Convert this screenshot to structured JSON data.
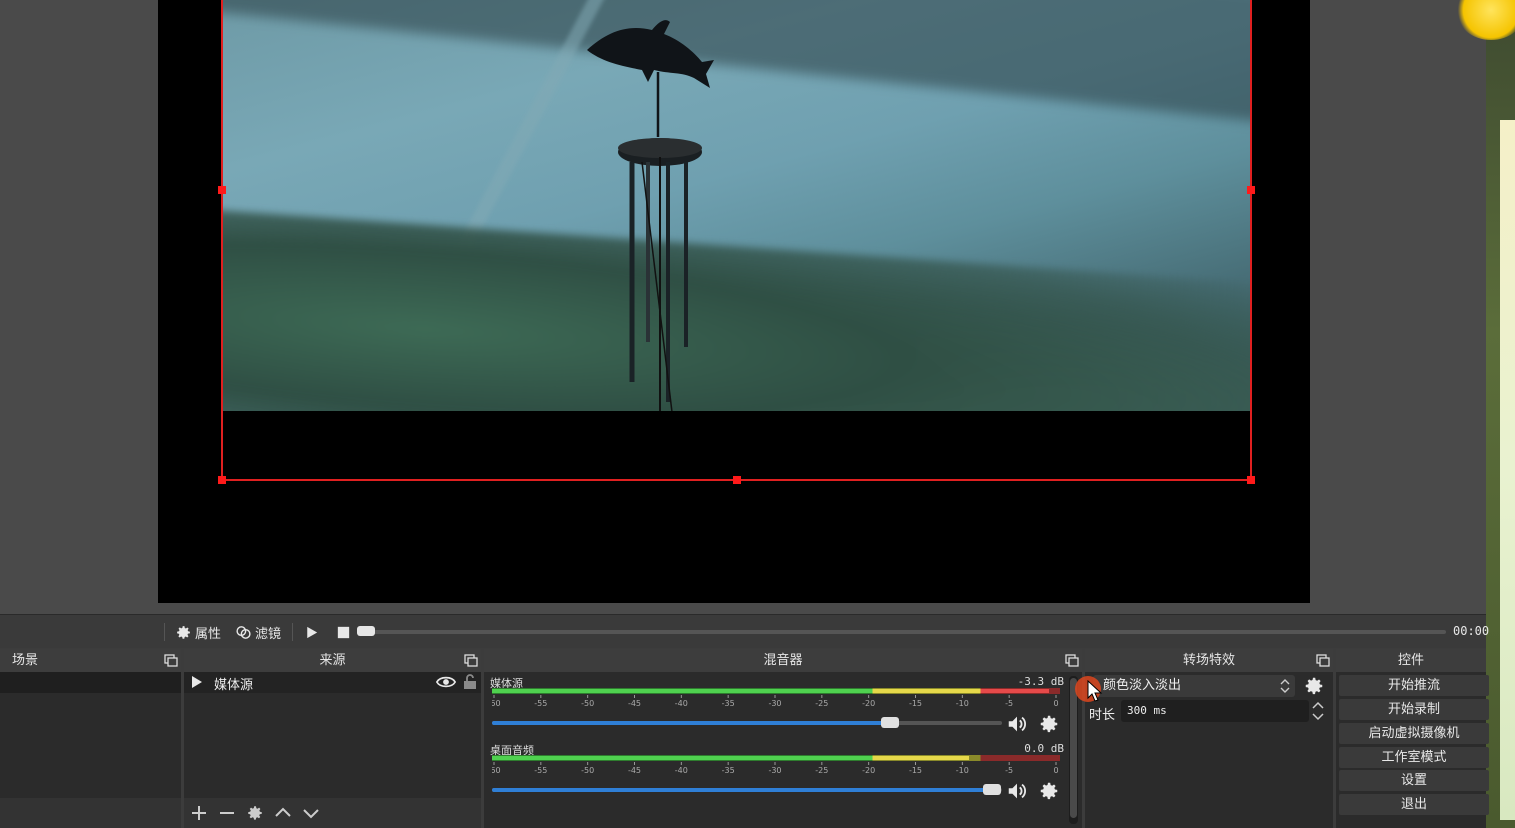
{
  "preview": {
    "source_label": "媒体源"
  },
  "media_toolbar": {
    "properties_label": "属性",
    "filters_label": "滤镜",
    "time": "00:00",
    "progress": 0.0
  },
  "scenes": {
    "title": "场景"
  },
  "sources": {
    "title": "来源",
    "items": [
      {
        "name": "媒体源"
      }
    ]
  },
  "mixer": {
    "title": "混音器",
    "scale_ticks": [
      "-60",
      "-55",
      "-50",
      "-45",
      "-40",
      "-35",
      "-30",
      "-25",
      "-20",
      "-15",
      "-10",
      "-5",
      "0"
    ],
    "channels": [
      {
        "name": "媒体源",
        "db": "-3.3 dB",
        "level": 0.98,
        "volume": 0.78
      },
      {
        "name": "桌面音频",
        "db": "0.0 dB",
        "level": 0.84,
        "volume": 0.98
      }
    ]
  },
  "transitions": {
    "title": "转场特效",
    "selected": "颜色淡入淡出",
    "duration_label": "时长",
    "duration_value": "300 ms"
  },
  "controls": {
    "title": "控件",
    "buttons": [
      {
        "label": "开始推流"
      },
      {
        "label": "开始录制"
      },
      {
        "label": "启动虚拟摄像机"
      },
      {
        "label": "工作室模式"
      },
      {
        "label": "设置"
      },
      {
        "label": "退出"
      }
    ]
  },
  "colors": {
    "selection": "#e02020",
    "volume_fill": "#2f7fd6",
    "meter_green": "#4fd14f",
    "meter_yellow": "#e6d84a",
    "meter_red": "#e64a4a"
  }
}
